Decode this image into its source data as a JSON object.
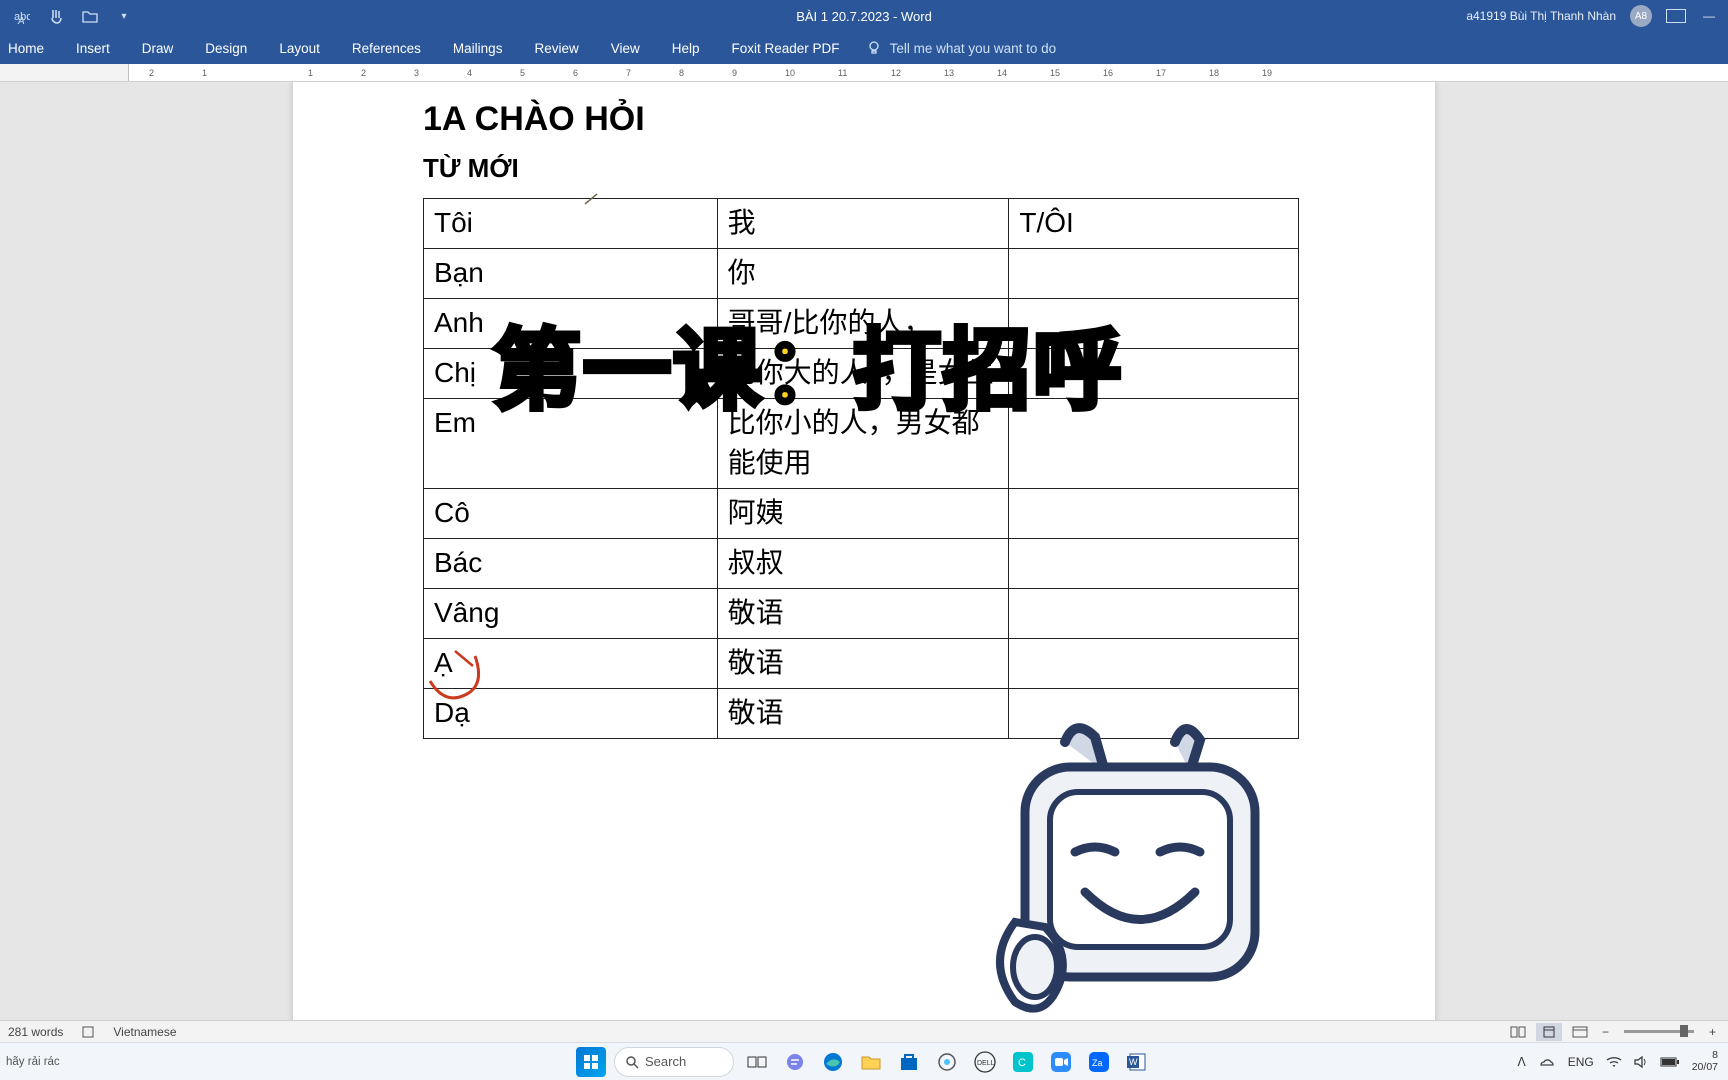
{
  "titlebar": {
    "doc_title": "BÀI 1 20.7.2023  -  Word",
    "user": "a41919 Bùi Thị Thanh Nhàn",
    "avatar": "A8"
  },
  "tabs": [
    "Home",
    "Insert",
    "Draw",
    "Design",
    "Layout",
    "References",
    "Mailings",
    "Review",
    "View",
    "Help",
    "Foxit Reader PDF"
  ],
  "tellme": "Tell me what you want to do",
  "ruler_numbers": [
    "2",
    "1",
    "",
    "1",
    "2",
    "3",
    "4",
    "5",
    "6",
    "7",
    "8",
    "9",
    "10",
    "11",
    "12",
    "13",
    "14",
    "15",
    "16",
    "17",
    "18",
    "19"
  ],
  "doc": {
    "h1": "1A CHÀO HỎI",
    "h2": "TỪ MỚI",
    "rows": [
      {
        "c1": "Tôi",
        "c2": "我",
        "c3": "T/ÔI"
      },
      {
        "c1": "Bạn",
        "c2": "你",
        "c3": ""
      },
      {
        "c1": "Anh",
        "c2": "哥哥/比你的人，",
        "c3": ""
      },
      {
        "c1": "Chị",
        "c2": "比你大的人。，是女生",
        "c3": ""
      },
      {
        "c1": "Em",
        "c2": "比你小的人，男女都能使用",
        "c3": ""
      },
      {
        "c1": "Cô",
        "c2": "阿姨",
        "c3": ""
      },
      {
        "c1": "Bác",
        "c2": "叔叔",
        "c3": ""
      },
      {
        "c1": "Vâng",
        "c2": "敬语",
        "c3": ""
      },
      {
        "c1": "Ạ",
        "c2": "敬语",
        "c3": ""
      },
      {
        "c1": "Dạ",
        "c2": "敬语",
        "c3": ""
      }
    ]
  },
  "overlay": "第一课：打招呼",
  "status": {
    "words": "281 words",
    "lang": "Vietnamese"
  },
  "taskbar": {
    "left_text": "hãy rải rác",
    "search": "Search",
    "lang": "ENG",
    "time_top": "8",
    "time_bottom": "20/07"
  }
}
